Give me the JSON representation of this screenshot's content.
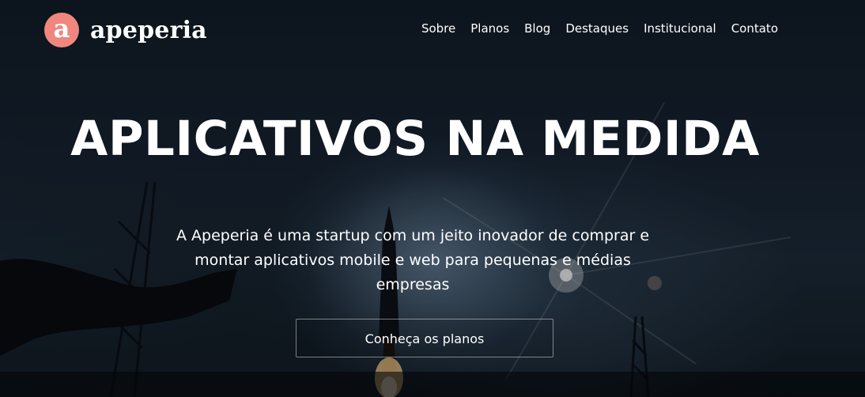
{
  "brand": {
    "logo_letter": "a",
    "name": "apeperia",
    "color": "#f0877e"
  },
  "nav": {
    "items": [
      "Sobre",
      "Planos",
      "Blog",
      "Destaques",
      "Institucional",
      "Contato"
    ]
  },
  "hero": {
    "headline": "APLICATIVOS NA MEDIDA",
    "subtitle": "A Apeperia é uma startup com um jeito inovador de comprar e montar aplicativos mobile e web para pequenas e médias empresas",
    "cta_label": "Conheça os planos"
  }
}
